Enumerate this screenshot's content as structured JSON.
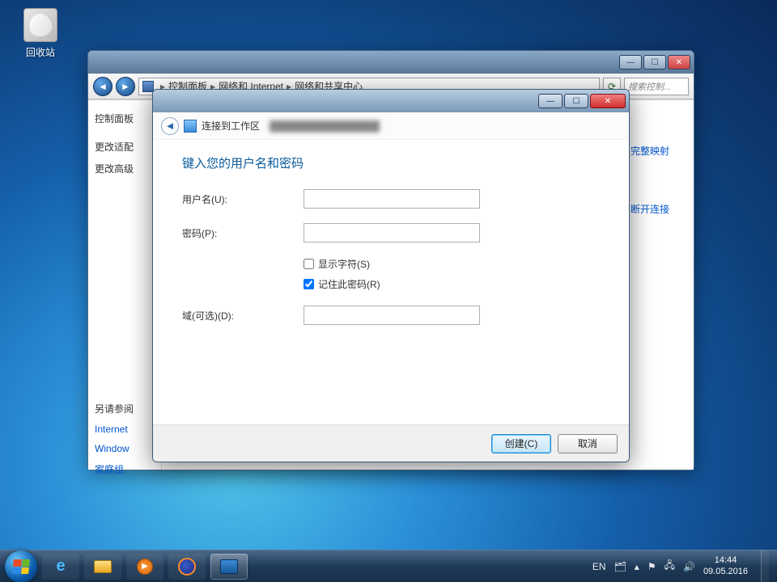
{
  "desktop": {
    "recycle_bin": "回收站"
  },
  "explorer": {
    "breadcrumb": [
      "控制面板",
      "网络和 Internet",
      "网络和共享中心"
    ],
    "search_placeholder": "搜索控制...",
    "sidebar": {
      "heading": "控制面板",
      "items": [
        "更改适配",
        "更改高级"
      ]
    },
    "right_links": {
      "map": "完整映射",
      "disconnect": "断开连接"
    },
    "see_also": {
      "heading": "另请参阅",
      "items": [
        "Internet",
        "Window",
        "家庭组"
      ]
    }
  },
  "dialog": {
    "title": "连接到工作区",
    "heading": "键入您的用户名和密码",
    "labels": {
      "username": "用户名(U):",
      "password": "密码(P):",
      "show_chars": "显示字符(S)",
      "remember": "记住此密码(R)",
      "domain": "域(可选)(D):"
    },
    "values": {
      "username": "",
      "password": "",
      "domain": "",
      "show_chars": false,
      "remember": true
    },
    "buttons": {
      "create": "创建(C)",
      "cancel": "取消"
    }
  },
  "taskbar": {
    "lang": "EN",
    "time": "14:44",
    "date": "09.05.2016"
  }
}
